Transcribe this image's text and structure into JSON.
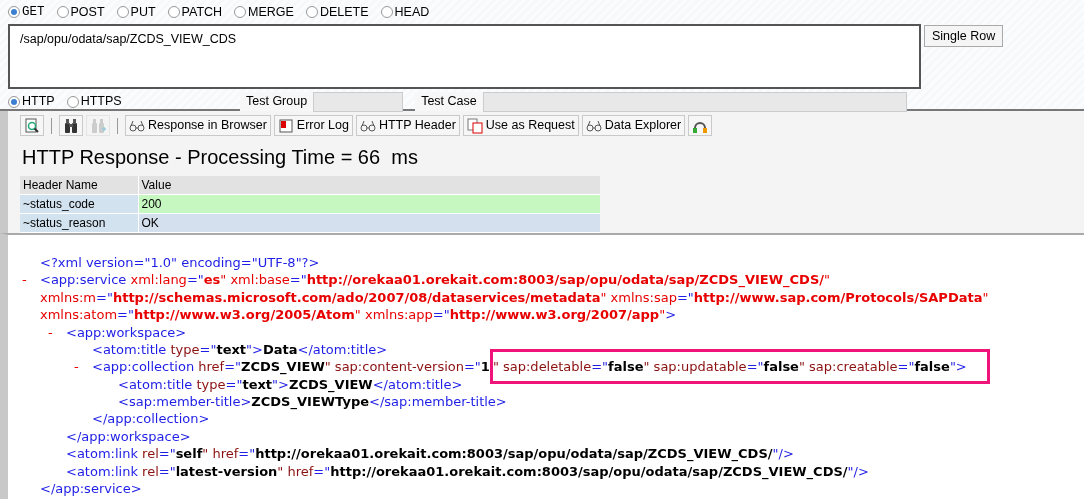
{
  "methods": [
    {
      "label": "GET",
      "selected": true
    },
    {
      "label": "POST",
      "selected": false
    },
    {
      "label": "PUT",
      "selected": false
    },
    {
      "label": "PATCH",
      "selected": false
    },
    {
      "label": "MERGE",
      "selected": false
    },
    {
      "label": "DELETE",
      "selected": false
    },
    {
      "label": "HEAD",
      "selected": false
    }
  ],
  "request_uri": "/sap/opu/odata/sap/ZCDS_VIEW_CDS",
  "single_row_button": "Single Row",
  "protocols": [
    {
      "label": "HTTP",
      "selected": true
    },
    {
      "label": "HTTPS",
      "selected": false
    }
  ],
  "test_group": {
    "label": "Test Group"
  },
  "test_case": {
    "label": "Test Case"
  },
  "toolbar": [
    {
      "kind": "search",
      "disabled": false
    },
    {
      "kind": "separator"
    },
    {
      "kind": "binoculars",
      "disabled": false
    },
    {
      "kind": "binoculars-plus",
      "disabled": true
    },
    {
      "kind": "separator"
    },
    {
      "kind": "glasses",
      "label": "Response in Browser",
      "disabled": false
    },
    {
      "kind": "log",
      "label": "Error Log",
      "disabled": false
    },
    {
      "kind": "glasses",
      "label": "HTTP Header",
      "disabled": false
    },
    {
      "kind": "copy",
      "label": "Use as Request",
      "disabled": false
    },
    {
      "kind": "glasses",
      "label": "Data Explorer",
      "disabled": false
    },
    {
      "kind": "network",
      "disabled": false
    }
  ],
  "response_title": "HTTP Response - Processing Time = 66  ms",
  "header_table": {
    "columns": [
      "Header Name",
      "Value"
    ],
    "rows": [
      {
        "cells": [
          "~status_code",
          "200"
        ],
        "color": "#c6f7c0"
      },
      {
        "cells": [
          "~status_reason",
          "OK"
        ],
        "color": "#d5e0ee"
      }
    ]
  },
  "xml": [
    {
      "tokens": [
        {
          "kind": "tag",
          "text": "<?xml version=\"1.0\" encoding=\"UTF-8\"?>"
        }
      ]
    },
    {
      "toggle": "-",
      "lines": [
        [
          {
            "kind": "tag",
            "text": "<app:service "
          },
          {
            "kind": "ns-attr",
            "text": "xml:lang"
          },
          {
            "kind": "tag",
            "text": "=\""
          },
          {
            "kind": "ns-value",
            "text": "es"
          },
          {
            "kind": "ns-attr",
            "text": "\" xml:base"
          },
          {
            "kind": "tag",
            "text": "=\""
          },
          {
            "kind": "ns-value",
            "text": "http://orekaa01.orekait.com:8003/sap/opu/odata/sap/ZCDS_VIEW_CDS/"
          },
          {
            "kind": "ns-attr",
            "text": "\""
          }
        ],
        [
          {
            "kind": "ns-attr",
            "text": "xmlns:m"
          },
          {
            "kind": "tag",
            "text": "=\""
          },
          {
            "kind": "ns-value",
            "text": "http://schemas.microsoft.com/ado/2007/08/dataservices/metadata"
          },
          {
            "kind": "ns-attr",
            "text": "\" xmlns:sap"
          },
          {
            "kind": "tag",
            "text": "=\""
          },
          {
            "kind": "ns-value",
            "text": "http://www.sap.com/Protocols/SAPData"
          },
          {
            "kind": "ns-attr",
            "text": "\""
          }
        ],
        [
          {
            "kind": "ns-attr",
            "text": "xmlns:atom"
          },
          {
            "kind": "tag",
            "text": "=\""
          },
          {
            "kind": "ns-value",
            "text": "http://www.w3.org/2005/Atom"
          },
          {
            "kind": "ns-attr",
            "text": "\" xmlns:app"
          },
          {
            "kind": "tag",
            "text": "=\""
          },
          {
            "kind": "ns-value",
            "text": "http://www.w3.org/2007/app"
          },
          {
            "kind": "ns-attr",
            "text": "\""
          },
          {
            "kind": "tag",
            "text": ">"
          }
        ]
      ],
      "children": [
        {
          "toggle": "-",
          "tokens": [
            {
              "kind": "tag",
              "text": "<app:workspace>"
            }
          ],
          "children": [
            {
              "tokens": [
                {
                  "kind": "tag",
                  "text": "<atom:title "
                },
                {
                  "kind": "attr",
                  "text": "type"
                },
                {
                  "kind": "tag",
                  "text": "=\""
                },
                {
                  "kind": "value",
                  "text": "text"
                },
                {
                  "kind": "tag",
                  "text": "\">"
                },
                {
                  "kind": "value",
                  "text": "Data"
                },
                {
                  "kind": "tag",
                  "text": "</atom:title>"
                }
              ]
            },
            {
              "toggle": "-",
              "tokens": [
                {
                  "kind": "tag",
                  "text": "<app:collection "
                },
                {
                  "kind": "attr",
                  "text": "href"
                },
                {
                  "kind": "tag",
                  "text": "=\""
                },
                {
                  "kind": "value",
                  "text": "ZCDS_VIEW"
                },
                {
                  "kind": "attr",
                  "text": "\" sap:content-version"
                },
                {
                  "kind": "tag",
                  "text": "=\""
                },
                {
                  "kind": "value",
                  "text": "1"
                }
              ],
              "highlighted": [
                {
                  "kind": "attr",
                  "text": "\" sap:deletable"
                },
                {
                  "kind": "tag",
                  "text": "=\""
                },
                {
                  "kind": "value",
                  "text": "false"
                },
                {
                  "kind": "attr",
                  "text": "\" sap:updatable"
                },
                {
                  "kind": "tag",
                  "text": "=\""
                },
                {
                  "kind": "value",
                  "text": "false"
                },
                {
                  "kind": "attr",
                  "text": "\" sap:creatable"
                },
                {
                  "kind": "tag",
                  "text": "=\""
                },
                {
                  "kind": "value",
                  "text": "false"
                },
                {
                  "kind": "tag",
                  "text": "\">"
                }
              ],
              "children": [
                {
                  "tokens": [
                    {
                      "kind": "tag",
                      "text": "<atom:title "
                    },
                    {
                      "kind": "attr",
                      "text": "type"
                    },
                    {
                      "kind": "tag",
                      "text": "=\""
                    },
                    {
                      "kind": "value",
                      "text": "text"
                    },
                    {
                      "kind": "tag",
                      "text": "\">"
                    },
                    {
                      "kind": "value",
                      "text": "ZCDS_VIEW"
                    },
                    {
                      "kind": "tag",
                      "text": "</atom:title>"
                    }
                  ]
                },
                {
                  "tokens": [
                    {
                      "kind": "tag",
                      "text": "<sap:member-title>"
                    },
                    {
                      "kind": "value",
                      "text": "ZCDS_VIEWType"
                    },
                    {
                      "kind": "tag",
                      "text": "</sap:member-title>"
                    }
                  ]
                }
              ]
            },
            {
              "tokens": [
                {
                  "kind": "tag",
                  "text": "</app:collection>"
                }
              ]
            }
          ]
        },
        {
          "tokens": [
            {
              "kind": "tag",
              "text": "</app:workspace>"
            }
          ]
        },
        {
          "tokens": [
            {
              "kind": "tag",
              "text": "<atom:link "
            },
            {
              "kind": "attr",
              "text": "rel"
            },
            {
              "kind": "tag",
              "text": "=\""
            },
            {
              "kind": "value",
              "text": "self"
            },
            {
              "kind": "attr",
              "text": "\" href"
            },
            {
              "kind": "tag",
              "text": "=\""
            },
            {
              "kind": "value",
              "text": "http://orekaa01.orekait.com:8003/sap/opu/odata/sap/ZCDS_VIEW_CDS/"
            },
            {
              "kind": "tag",
              "text": "\"/>"
            }
          ]
        },
        {
          "tokens": [
            {
              "kind": "tag",
              "text": "<atom:link "
            },
            {
              "kind": "attr",
              "text": "rel"
            },
            {
              "kind": "tag",
              "text": "=\""
            },
            {
              "kind": "value",
              "text": "latest-version"
            },
            {
              "kind": "attr",
              "text": "\" href"
            },
            {
              "kind": "tag",
              "text": "=\""
            },
            {
              "kind": "value",
              "text": "http://orekaa01.orekait.com:8003/sap/opu/odata/sap/ZCDS_VIEW_CDS/"
            },
            {
              "kind": "tag",
              "text": "\"/>"
            }
          ]
        }
      ]
    },
    {
      "tokens": [
        {
          "kind": "tag",
          "text": "</app:service>"
        }
      ]
    }
  ]
}
